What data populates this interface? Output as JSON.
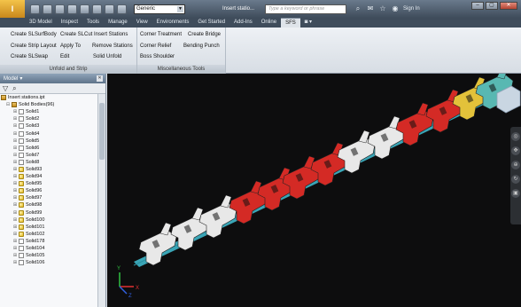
{
  "titlebar": {
    "style_combo": "Generic",
    "document_title": "Insert statio...",
    "search_placeholder": "Type a keyword or phrase",
    "signin": "Sign In"
  },
  "tabs": [
    "3D Model",
    "Inspect",
    "Tools",
    "Manage",
    "View",
    "Environments",
    "Get Started",
    "Add-Ins",
    "Online",
    "SFS"
  ],
  "active_tab": "SFS",
  "ribbon": {
    "unfold_group": {
      "title": "Unfold and Strip",
      "buttons": {
        "create_sl_surf_body": "Create SLSurfBody",
        "create_sl_cut": "Create SLCut",
        "insert_stations": "Insert Stations",
        "create_strip_layout": "Create Strip Layout",
        "apply_to": "Apply To",
        "remove_stations": "Remove Stations",
        "create_sl_swap": "Create SLSwap",
        "edit": "Edit",
        "solid_unfold": "Solid Unfold"
      }
    },
    "misc_group": {
      "title": "Miscellaneous Tools",
      "buttons": {
        "corner_treatment": "Corner Treatment",
        "create_bridge": "Create Bridge",
        "corner_relief": "Corner Relief",
        "bending_punch": "Bending Punch",
        "boss_shoulder": "Boss Shoulder"
      }
    }
  },
  "browser": {
    "title": "Model",
    "root": "Insert stations.ipt",
    "solid_bodies": "Solid Bodies(96)",
    "items": [
      {
        "label": "Solid1",
        "type": "plain"
      },
      {
        "label": "Solid2",
        "type": "plain"
      },
      {
        "label": "Solid3",
        "type": "plain"
      },
      {
        "label": "Solid4",
        "type": "plain"
      },
      {
        "label": "Solid5",
        "type": "plain"
      },
      {
        "label": "Solid6",
        "type": "plain"
      },
      {
        "label": "Solid7",
        "type": "plain"
      },
      {
        "label": "Solid8",
        "type": "plain"
      },
      {
        "label": "Solid93",
        "type": "solid"
      },
      {
        "label": "Solid94",
        "type": "solid"
      },
      {
        "label": "Solid95",
        "type": "solid"
      },
      {
        "label": "Solid96",
        "type": "solid"
      },
      {
        "label": "Solid97",
        "type": "solid"
      },
      {
        "label": "Solid98",
        "type": "solid"
      },
      {
        "label": "Solid99",
        "type": "solid"
      },
      {
        "label": "Solid100",
        "type": "solid"
      },
      {
        "label": "Solid101",
        "type": "solid"
      },
      {
        "label": "Solid102",
        "type": "solid"
      },
      {
        "label": "Solid178",
        "type": "plain"
      },
      {
        "label": "Solid104",
        "type": "plain"
      },
      {
        "label": "Solid105",
        "type": "plain"
      },
      {
        "label": "Solid106",
        "type": "plain"
      }
    ]
  },
  "viewport": {
    "axis_labels": {
      "x": "X",
      "y": "Y",
      "z": "Z"
    },
    "colors": {
      "background": "#0d0d0e",
      "white_part": "#e8e8e8",
      "red_part": "#d42a25",
      "strip": "#3fb6c9",
      "teal_part": "#58b8b2",
      "yellow_part": "#e3c23a"
    }
  }
}
